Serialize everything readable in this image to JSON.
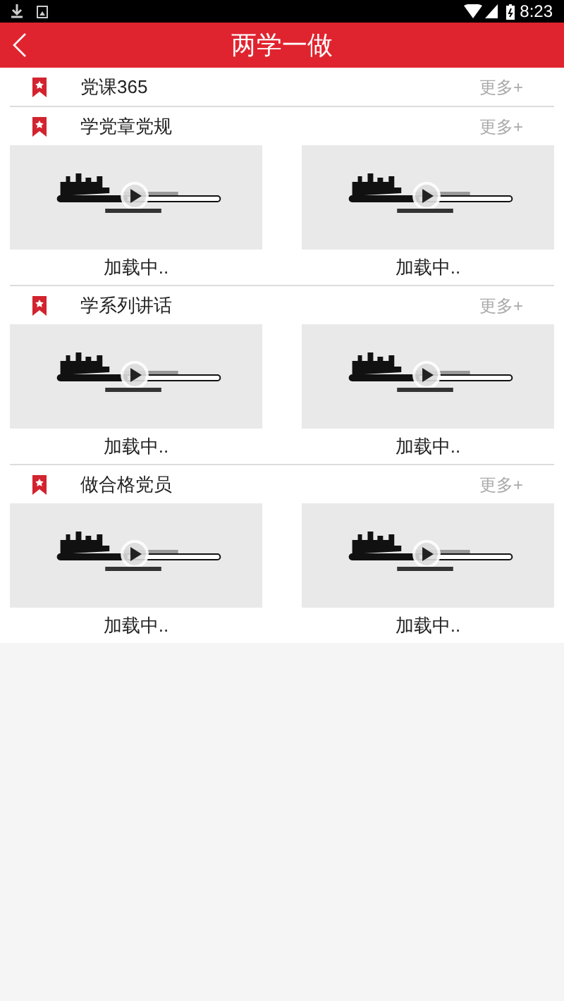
{
  "status_bar": {
    "time": "8:23"
  },
  "header": {
    "title": "两学一做"
  },
  "sections": [
    {
      "title": "党课365",
      "more": "更多+"
    },
    {
      "title": "学党章党规",
      "more": "更多+",
      "videos": [
        {
          "caption": "加载中.."
        },
        {
          "caption": "加载中.."
        }
      ]
    },
    {
      "title": "学系列讲话",
      "more": "更多+",
      "videos": [
        {
          "caption": "加载中.."
        },
        {
          "caption": "加载中.."
        }
      ]
    },
    {
      "title": "做合格党员",
      "more": "更多+",
      "videos": [
        {
          "caption": "加载中.."
        },
        {
          "caption": "加载中.."
        }
      ]
    }
  ]
}
